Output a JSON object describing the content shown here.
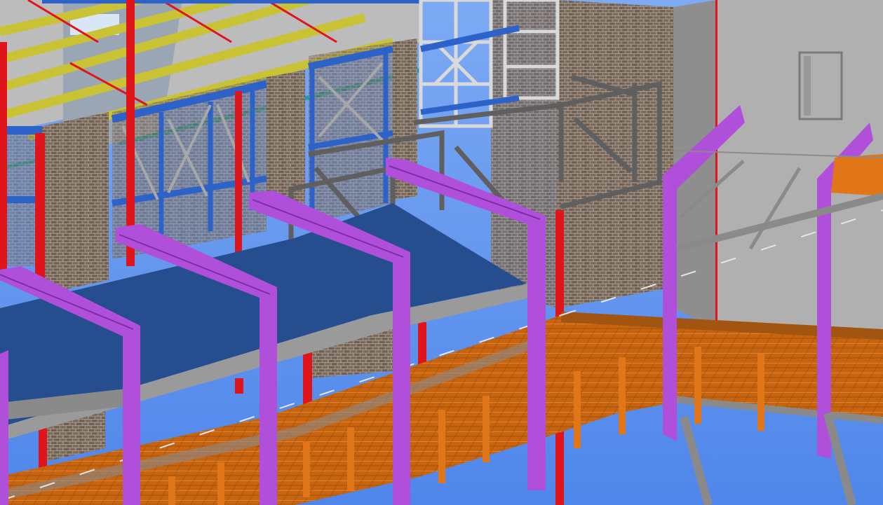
{
  "viewport": {
    "kind": "3D structural BIM model view (no visible UI chrome)"
  },
  "colors": {
    "sky": "#6f9ff0",
    "sky_light": "#9cc2f8",
    "grey_wall": "#9c9c9c",
    "grey_wall_light": "#b9b9b9",
    "brick": "#7a6a5e",
    "brick_mortar": "#a6988a",
    "blue_steel": "#2d62c9",
    "red_column": "#e0141b",
    "yellow_beam": "#c9c234",
    "cyan_beam": "#1ba0a8",
    "purple_frame": "#b04fd9",
    "purple_dark": "#7d2ea6",
    "blue_slab": "#264e8f",
    "orange_grating": "#d06a10",
    "orange_post": "#e07618",
    "grey_steel": "#8a8a8a",
    "white_steel": "#d9d9d9"
  }
}
